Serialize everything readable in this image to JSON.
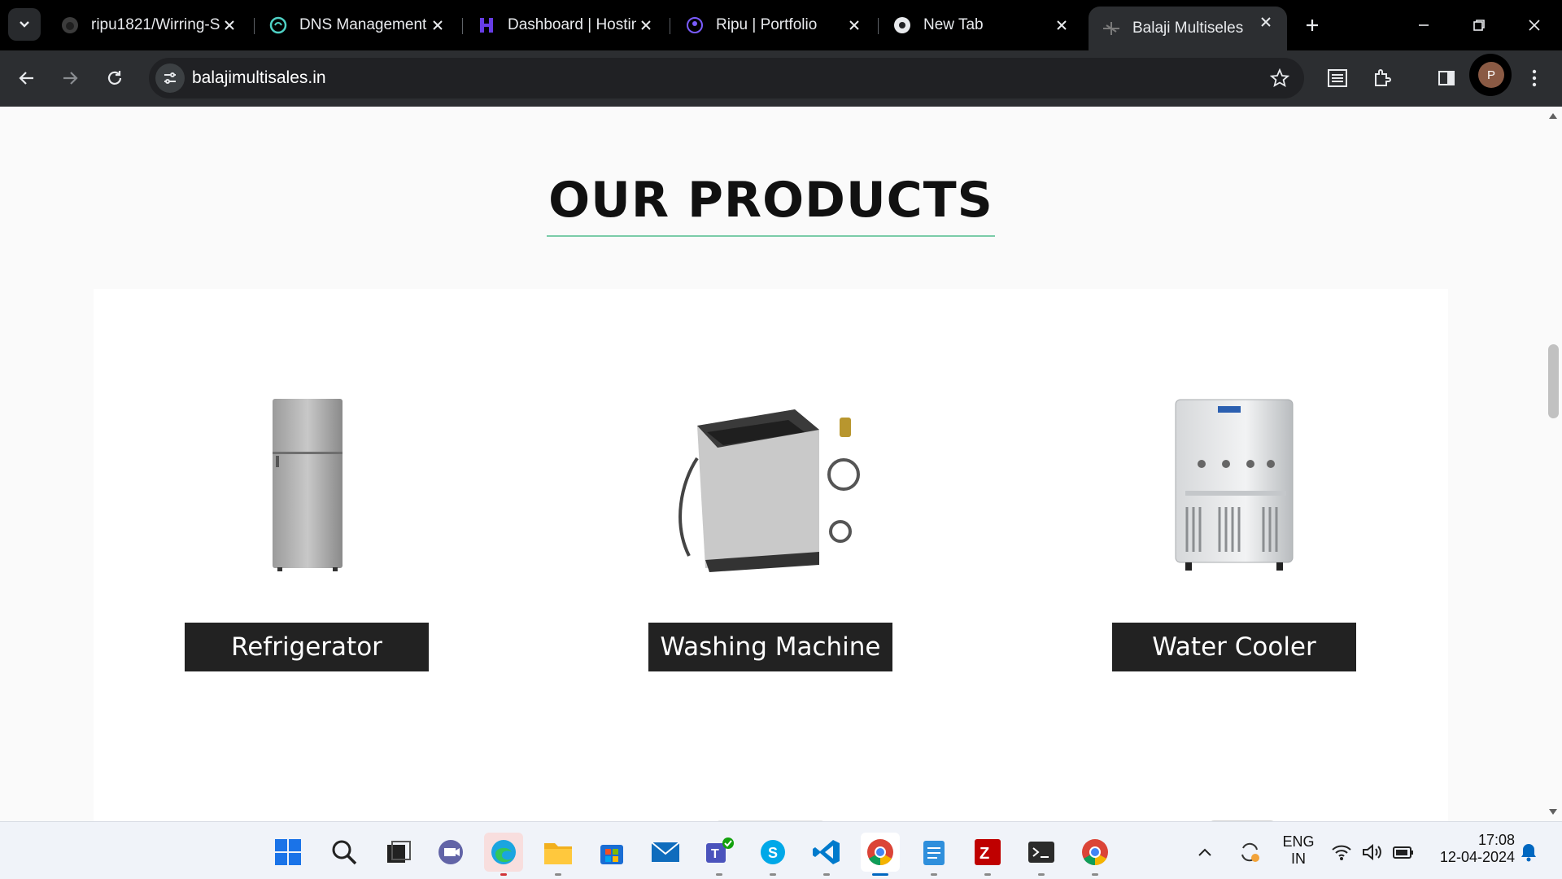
{
  "browser": {
    "tabs": [
      {
        "title": "ripu1821/Wirring-S",
        "icon": "github-icon"
      },
      {
        "title": "DNS Management",
        "icon": "dns-icon"
      },
      {
        "title": "Dashboard | Hostin",
        "icon": "hostinger-icon"
      },
      {
        "title": "Ripu | Portfolio",
        "icon": "portfolio-icon"
      },
      {
        "title": "New Tab",
        "icon": "chrome-icon"
      },
      {
        "title": "Balaji Multiseles",
        "icon": "site-icon",
        "active": true
      }
    ],
    "url": "balajimultisales.in",
    "profile_initial": "P"
  },
  "page": {
    "heading": "OUR PRODUCTS",
    "products": [
      {
        "name": "Refrigerator",
        "icon": "refrigerator-image"
      },
      {
        "name": "Washing Machine",
        "icon": "washing-machine-image"
      },
      {
        "name": "Water Cooler",
        "icon": "water-cooler-image"
      }
    ]
  },
  "taskbar": {
    "language_top": "ENG",
    "language_bottom": "IN",
    "time": "17:08",
    "date": "12-04-2024"
  },
  "colors": {
    "heading_underline": "#7bcca8",
    "label_bg": "#222222",
    "accent": "#0067c0"
  }
}
